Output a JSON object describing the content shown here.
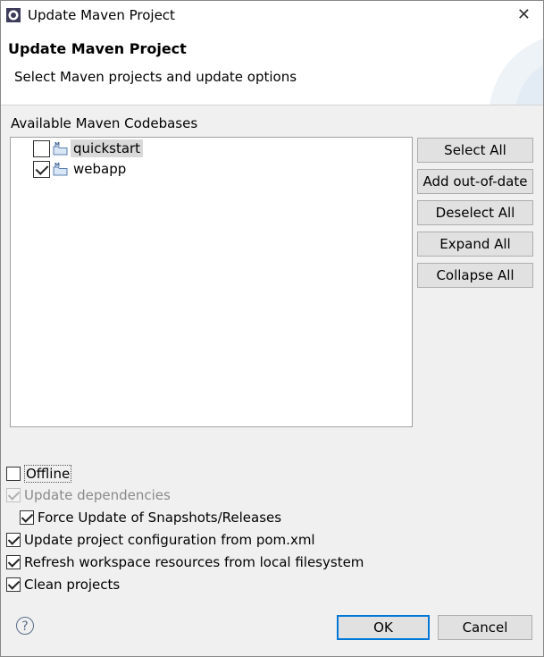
{
  "window": {
    "title": "Update Maven Project",
    "close_glyph": "✕"
  },
  "banner": {
    "title": "Update Maven Project",
    "message": "Select Maven projects and update options"
  },
  "codebases": {
    "label": "Available Maven Codebases",
    "items": [
      {
        "label": "quickstart",
        "checked": false,
        "selected": true,
        "icon": "maven-project-icon"
      },
      {
        "label": "webapp",
        "checked": true,
        "selected": false,
        "icon": "maven-project-icon"
      }
    ]
  },
  "side_buttons": {
    "select_all": "Select All",
    "add_out_of_date": "Add out-of-date",
    "deselect_all": "Deselect All",
    "expand_all": "Expand All",
    "collapse_all": "Collapse All"
  },
  "options": {
    "offline": {
      "label": "Offline",
      "checked": false,
      "enabled": true
    },
    "update_dependencies": {
      "label": "Update dependencies",
      "checked": true,
      "enabled": false
    },
    "force_update": {
      "label": "Force Update of Snapshots/Releases",
      "checked": true,
      "enabled": true
    },
    "update_config": {
      "label": "Update project configuration from pom.xml",
      "checked": true,
      "enabled": true
    },
    "refresh_workspace": {
      "label": "Refresh workspace resources from local filesystem",
      "checked": true,
      "enabled": true
    },
    "clean_projects": {
      "label": "Clean projects",
      "checked": true,
      "enabled": true
    }
  },
  "footer": {
    "help_glyph": "?",
    "ok": "OK",
    "cancel": "Cancel"
  },
  "colors": {
    "default_button_border": "#0078d7",
    "disabled_text": "#8a8a8a"
  }
}
